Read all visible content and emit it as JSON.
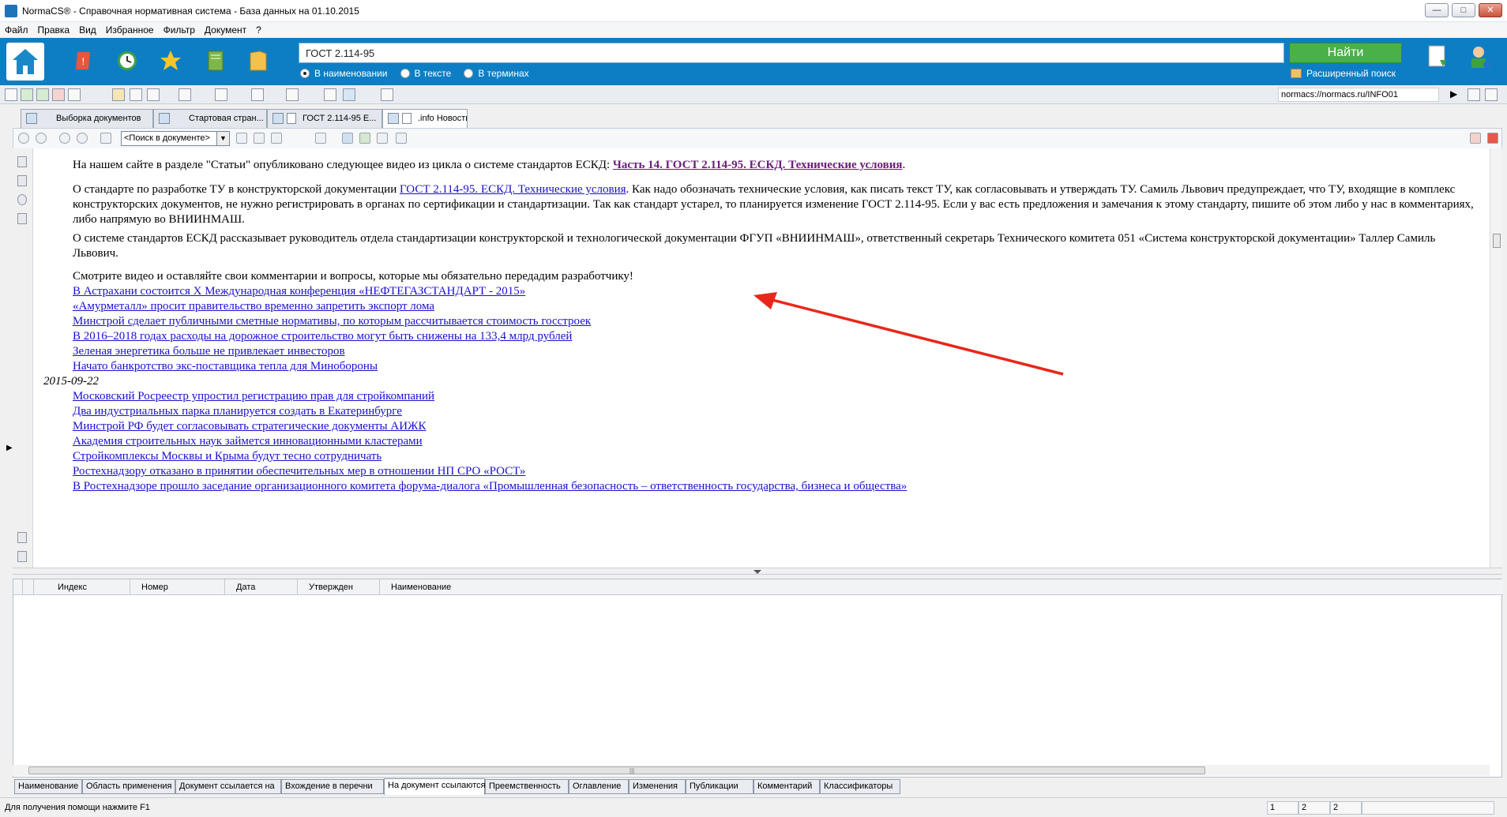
{
  "window": {
    "title": "NormaCS® - Справочная нормативная система - База данных на 01.10.2015",
    "buttons": {
      "minimize": "—",
      "maximize": "□",
      "close": "✕"
    }
  },
  "menu": [
    "Файл",
    "Правка",
    "Вид",
    "Избранное",
    "Фильтр",
    "Документ",
    "?"
  ],
  "search": {
    "value": "ГОСТ 2.114-95",
    "find_label": "Найти",
    "options": [
      "В наименовании",
      "В тексте",
      "В терминах"
    ],
    "selected_option": "В наименовании",
    "advanced_label": "Расширенный поиск"
  },
  "toolbar": {
    "url": "normacs://normacs.ru/INFO01"
  },
  "tabs": [
    {
      "label": "Выборка документов"
    },
    {
      "label": "Стартовая стран..."
    },
    {
      "label": "ГОСТ 2.114-95 Е..."
    },
    {
      "label": ".info Новости"
    }
  ],
  "doc_toolbar": {
    "search_placeholder": "<Поиск в документе>"
  },
  "document": {
    "p1_text": "На нашем сайте в разделе \"Статьи\" опубликовано следующее видео из цикла о системе стандартов ЕСКД: ",
    "p1_link": "Часть 14. ГОСТ 2.114-95. ЕСКД. Технические условия",
    "p1_end": ".",
    "p2_text_a": "О стандарте по разработке ТУ в конструкторской документации ",
    "p2_link": "ГОСТ 2.114-95. ЕСКД. Технические условия",
    "p2_text_b": ". Как надо обозначать технические условия, как писать текст ТУ, как согласовывать и утверждать ТУ. Самиль Львович предупреждает, что ТУ, входящие в комплекс конструкторских документов, не нужно регистрировать в органах по сертификации и стандартизации.  Так как стандарт устарел, то планируется изменение ГОСТ 2.114-95. Если у вас есть предложения и замечания к этому стандарту, пишите об этом либо у нас в комментариях, либо напрямую во ВНИИНМАШ.",
    "p3_text": "О системе стандартов ЕСКД рассказывает руководитель отдела стандартизации конструкторской и технологической документации ФГУП «ВНИИНМАШ», ответственный секретарь Технического комитета 051 «Система конструкторской документации» Таллер Самиль Львович.",
    "p4_text": "Смотрите видео и оставляйте свои комментарии и вопросы, которые мы обязательно передадим разработчику!",
    "links_group1": [
      "В Астрахани состоится X Международная конференция «НЕФТЕГАЗСТАНДАРТ - 2015»",
      "«Амурметалл» просит правительство временно запретить экспорт лома",
      "Минстрой сделает публичными сметные нормативы, по которым рассчитывается стоимость госстроек",
      "В 2016–2018 годах расходы на дорожное строительство могут быть снижены на 133,4 млрд рублей",
      "Зеленая энергетика больше не привлекает инвесторов",
      "Начато банкротство экс-поставщика тепла для Минобороны"
    ],
    "date2": "2015-09-22",
    "links_group2": [
      "Московский Росреестр упростил регистрацию прав для стройкомпаний",
      "Два индустриальных парка планируется создать в Екатеринбурге",
      "Минстрой РФ будет согласовывать стратегические документы АИЖК",
      "Академия строительных наук займется инновационными кластерами",
      "Стройкомплексы Москвы и Крыма будут тесно сотрудничать",
      "Ростехнадзору отказано в принятии обеспечительных мер в отношении НП СРО «РОСТ»",
      "В Ростехнадзоре прошло заседание организационного комитета форума-диалога «Промышленная безопасность – ответственность государства, бизнеса и общества»"
    ]
  },
  "grid": {
    "columns": [
      "Индекс",
      "Номер",
      "Дата",
      "Утвержден",
      "Наименование"
    ]
  },
  "bottom_tabs": [
    "Наименование",
    "Область применения",
    "Документ ссылается на",
    "Вхождение в перечни",
    "На документ ссылаются",
    "Преемственность",
    "Оглавление",
    "Изменения",
    "Публикации",
    "Комментарий",
    "Классификаторы"
  ],
  "bottom_active": "На документ ссылаются",
  "status": {
    "help": "Для получения помощи нажмите F1",
    "cells": [
      "1",
      "2",
      "2"
    ]
  },
  "colors": {
    "header_blue": "#0d7ec4",
    "find_green": "#49b04a",
    "arrow_red": "#e8271a"
  }
}
